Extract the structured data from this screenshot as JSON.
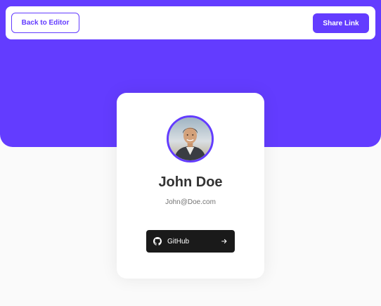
{
  "header": {
    "back_label": "Back to Editor",
    "share_label": "Share Link"
  },
  "profile": {
    "name": "John Doe",
    "email": "John@Doe.com",
    "avatar_icon": "profile-photo"
  },
  "links": [
    {
      "platform": "GitHub",
      "icon": "github-icon",
      "action_icon": "arrow-right-icon"
    }
  ],
  "colors": {
    "accent": "#633cff",
    "background": "#fafafa",
    "card": "#ffffff",
    "github": "#1a1a1a",
    "name_text": "#333333",
    "email_text": "#737373"
  }
}
